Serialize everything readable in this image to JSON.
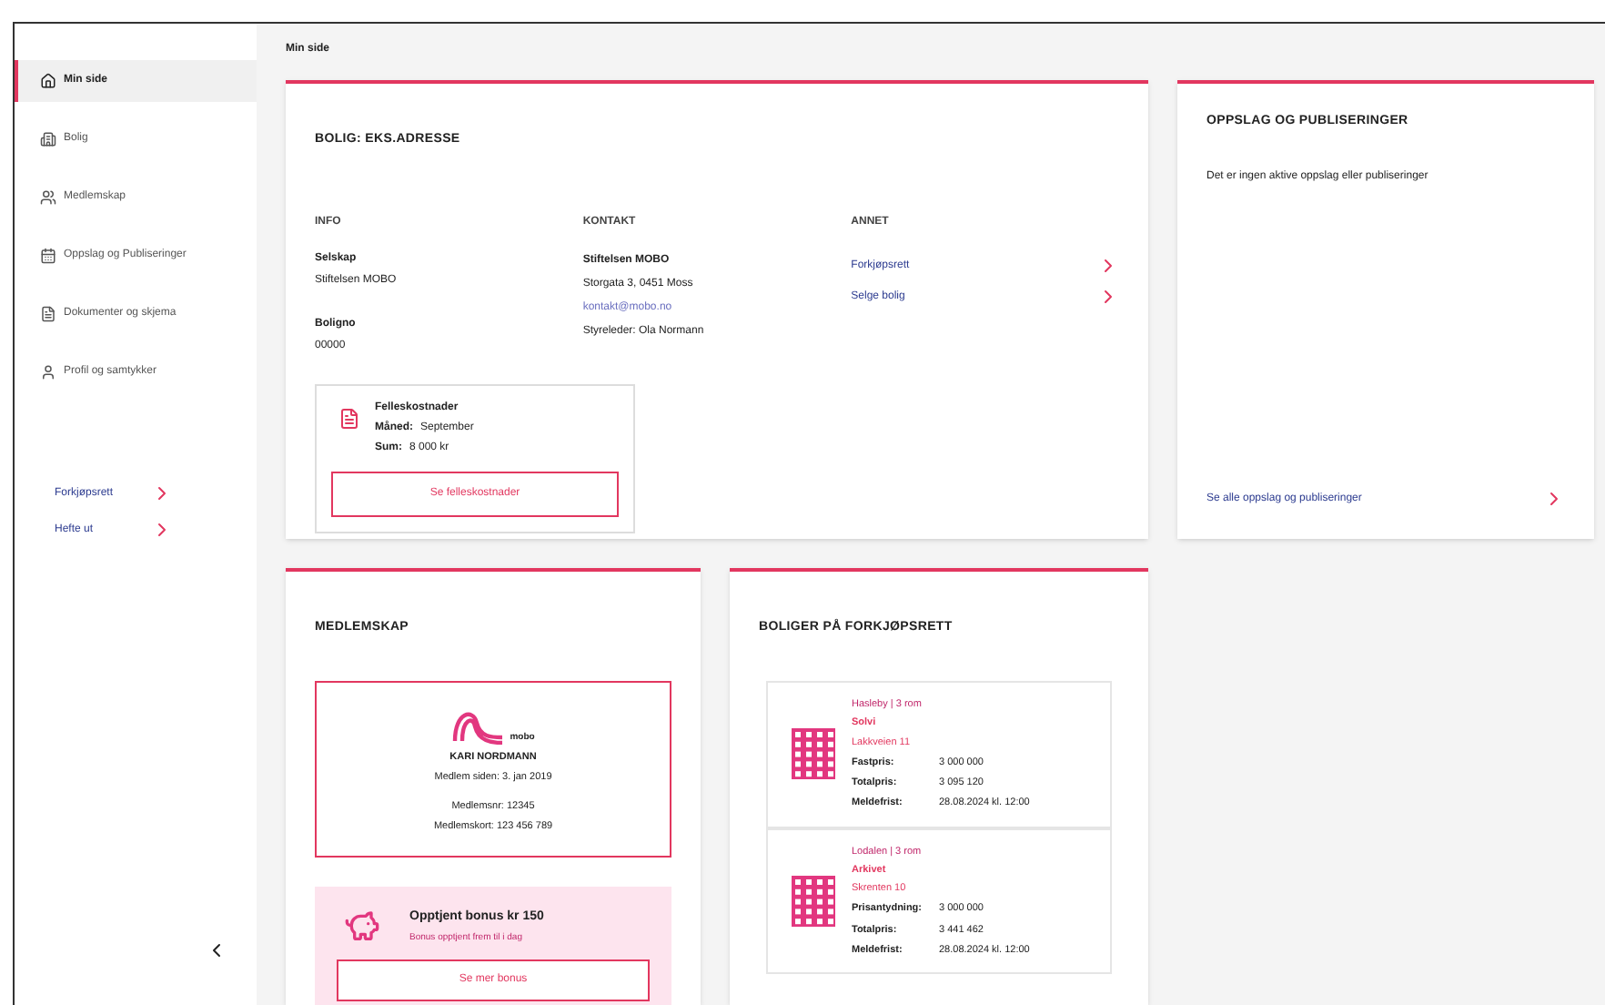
{
  "sidebar": {
    "items": [
      {
        "label": "Min side",
        "selected": true
      },
      {
        "label": "Bolig",
        "selected": false
      },
      {
        "label": "Medlemskap",
        "selected": false
      },
      {
        "label": "Oppslag og Publiseringer",
        "selected": false
      },
      {
        "label": "Dokumenter og skjema",
        "selected": false
      },
      {
        "label": "Profil og samtykker",
        "selected": false
      }
    ],
    "links": [
      {
        "label": "Forkjøpsrett"
      },
      {
        "label": "Hefte ut"
      }
    ]
  },
  "breadcrumb": "Min side",
  "bolig": {
    "title": "BOLIG: EKS.ADRESSE",
    "info": {
      "heading": "INFO",
      "fields": [
        {
          "label": "Selskap",
          "value": "Stiftelsen MOBO"
        },
        {
          "label": "Boligno",
          "value": "00000"
        }
      ]
    },
    "kontakt": {
      "heading": "KONTAKT",
      "name": "Stiftelsen MOBO",
      "address": "Storgata 3, 0451 Moss",
      "email": "kontakt@mobo.no",
      "leader": "Styreleder: Ola Normann"
    },
    "annet": {
      "heading": "ANNET",
      "links": [
        "Forkjøpsrett",
        "Selge bolig"
      ]
    },
    "fees": {
      "title": "Felleskostnader",
      "month_label": "Måned:",
      "month": "September",
      "sum_label": "Sum:",
      "sum": "8 000 kr",
      "button": "Se felleskostnader"
    }
  },
  "oppslag": {
    "title": "OPPSLAG OG PUBLISERINGER",
    "empty": "Det er ingen aktive oppslag eller publiseringer",
    "link": "Se alle oppslag og publiseringer"
  },
  "medlemskap": {
    "title": "MEDLEMSKAP",
    "logo_text": "mobo",
    "name": "KARI NORDMANN",
    "since": "Medlem siden: 3. jan 2019",
    "number": "Medlemsnr: 12345",
    "card": "Medlemskort: 123 456 789",
    "bonus_title": "Opptjent bonus kr 150",
    "bonus_sub": "Bonus opptjent frem til i dag",
    "bonus_button": "Se mer bonus"
  },
  "forkjop": {
    "title": "BOLIGER PÅ FORKJØPSRETT",
    "items": [
      {
        "area": "Hasleby | 3 rom",
        "name": "Solvi",
        "street": "Lakkveien 11",
        "rows": [
          {
            "label": "Fastpris:",
            "value": "3 000 000"
          },
          {
            "label": "Totalpris:",
            "value": "3 095 120"
          },
          {
            "label": "Meldefrist:",
            "value": "28.08.2024 kl. 12:00"
          }
        ]
      },
      {
        "area": "Lodalen | 3 rom",
        "name": "Arkivet",
        "street": "Skrenten 10",
        "rows": [
          {
            "label": "Prisantydning:",
            "value": "3 000 000"
          },
          {
            "label": "Totalpris:",
            "value": "3 441 462"
          },
          {
            "label": "Meldefrist:",
            "value": "28.08.2024 kl. 12:00"
          }
        ]
      }
    ]
  }
}
